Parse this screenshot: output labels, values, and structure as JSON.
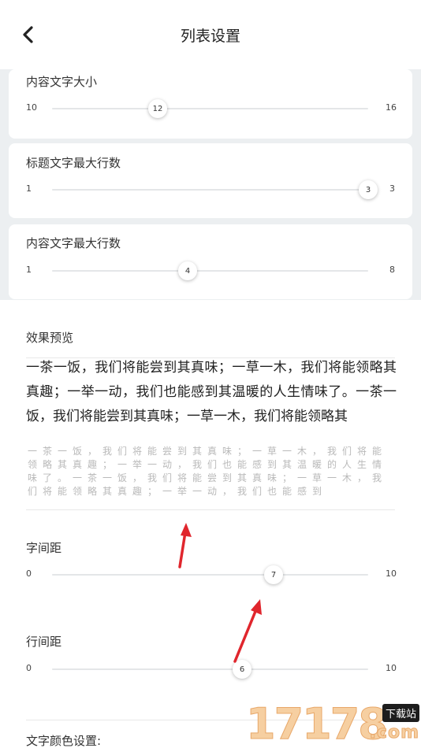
{
  "header": {
    "title": "列表设置",
    "back_icon": "chevron-left-icon"
  },
  "content_size": {
    "label": "内容文字大小",
    "min": "10",
    "max": "16",
    "value": "12",
    "fraction": 0.33
  },
  "title_lines": {
    "label": "标题文字最大行数",
    "min": "1",
    "max": "3",
    "value": "3",
    "fraction": 1.0
  },
  "content_lines": {
    "label": "内容文字最大行数",
    "min": "1",
    "max": "8",
    "value": "4",
    "fraction": 0.43
  },
  "preview": {
    "label": "效果预览",
    "title_text": "一茶一饭，我们将能尝到其真味；一草一木，我们将能领略其真趣；一举一动，我们也能感到其温暖的人生情味了。一茶一饭，我们将能尝到其真味；一草一木，我们将能领略其",
    "content_text": "一茶一饭，我们将能尝到其真味；一草一木，我们将能领略其真趣；一举一动，我们也能感到其温暖的人生情味了。一茶一饭，我们将能尝到其真味；一草一木，我们将能领略其真趣；一举一动，我们也能感到"
  },
  "letter_spacing": {
    "label": "字间距",
    "min": "0",
    "max": "10",
    "value": "7",
    "fraction": 0.7
  },
  "line_spacing": {
    "label": "行间距",
    "min": "0",
    "max": "10",
    "value": "6",
    "fraction": 0.6
  },
  "text_color": {
    "label": "文字颜色设置:"
  },
  "watermark": {
    "number": "17178",
    "tag": "下载站",
    "domain": ".com"
  },
  "colors": {
    "accent_arrow": "#e0262d",
    "background": "#eceff1"
  }
}
